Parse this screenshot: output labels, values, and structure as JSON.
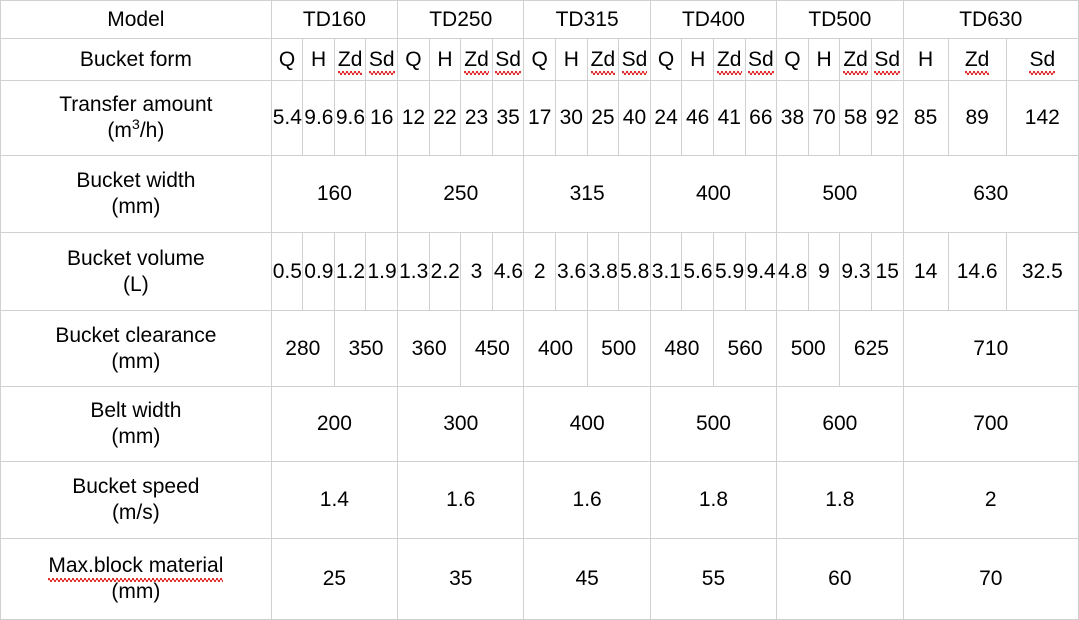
{
  "table": {
    "row_labels": {
      "model": "Model",
      "bucket_form": "Bucket form",
      "transfer_amount": "Transfer amount",
      "transfer_amount_unit": "(m³/h)",
      "transfer_amount_unit_base": "(m",
      "transfer_amount_unit_sup": "3",
      "transfer_amount_unit_tail": "/h)",
      "bucket_width": "Bucket width",
      "bucket_width_unit": "(mm)",
      "bucket_volume": "Bucket volume",
      "bucket_volume_unit": "(L)",
      "bucket_clearance": "Bucket clearance",
      "bucket_clearance_unit": "(mm)",
      "belt_width": "Belt width",
      "belt_width_unit": "(mm)",
      "bucket_speed": "Bucket speed",
      "bucket_speed_unit": "(m/s)",
      "max_block_material": "Max.block material",
      "max_block_material_unit": "(mm)"
    },
    "models": [
      "TD160",
      "TD250",
      "TD315",
      "TD400",
      "TD500",
      "TD630"
    ],
    "bucket_forms": [
      [
        "Q",
        "H",
        "Zd",
        "Sd"
      ],
      [
        "Q",
        "H",
        "Zd",
        "Sd"
      ],
      [
        "Q",
        "H",
        "Zd",
        "Sd"
      ],
      [
        "Q",
        "H",
        "Zd",
        "Sd"
      ],
      [
        "Q",
        "H",
        "Zd",
        "Sd"
      ],
      [
        "H",
        "Zd",
        "Sd"
      ]
    ],
    "transfer_amount": [
      [
        "5.4",
        "9.6",
        "9.6",
        "16"
      ],
      [
        "12",
        "22",
        "23",
        "35"
      ],
      [
        "17",
        "30",
        "25",
        "40"
      ],
      [
        "24",
        "46",
        "41",
        "66"
      ],
      [
        "38",
        "70",
        "58",
        "92"
      ],
      [
        "85",
        "89",
        "142"
      ]
    ],
    "bucket_width": [
      "160",
      "250",
      "315",
      "400",
      "500",
      "630"
    ],
    "bucket_volume": [
      [
        "0.5",
        "0.9",
        "1.2",
        "1.9"
      ],
      [
        "1.3",
        "2.2",
        "3",
        "4.6"
      ],
      [
        "2",
        "3.6",
        "3.8",
        "5.8"
      ],
      [
        "3.1",
        "5.6",
        "5.9",
        "9.4"
      ],
      [
        "4.8",
        "9",
        "9.3",
        "15"
      ],
      [
        "14",
        "14.6",
        "32.5"
      ]
    ],
    "bucket_clearance": [
      [
        "280",
        "350"
      ],
      [
        "360",
        "450"
      ],
      [
        "400",
        "500"
      ],
      [
        "480",
        "560"
      ],
      [
        "500",
        "625"
      ],
      [
        "710"
      ]
    ],
    "belt_width": [
      "200",
      "300",
      "400",
      "500",
      "600",
      "700"
    ],
    "bucket_speed": [
      "1.4",
      "1.6",
      "1.6",
      "1.8",
      "1.8",
      "2"
    ],
    "max_block_material": [
      "25",
      "35",
      "45",
      "55",
      "60",
      "70"
    ],
    "spellcheck_terms": [
      "Zd",
      "Sd",
      "Max.block"
    ],
    "colors": {
      "border": "#d0d0d0",
      "text": "#000000",
      "background": "#ffffff",
      "spellcheck_underline": "#e03030"
    }
  }
}
